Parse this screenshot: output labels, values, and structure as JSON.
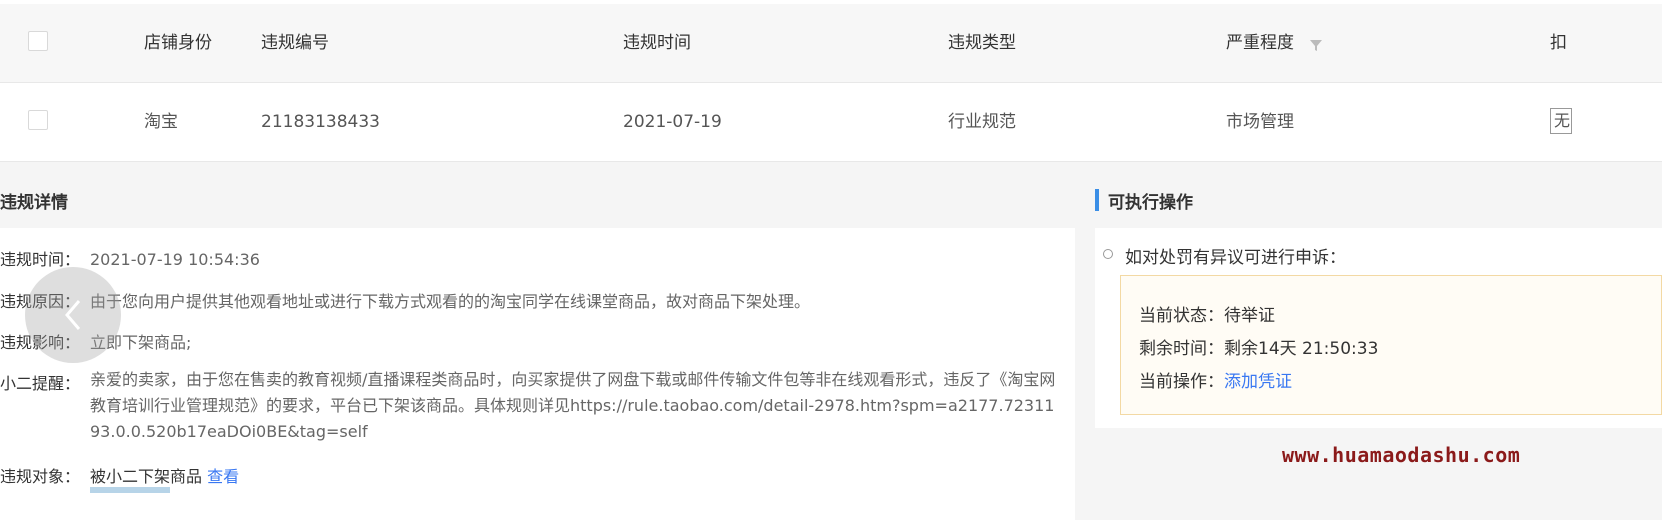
{
  "table": {
    "headers": [
      "店铺身份",
      "违规编号",
      "违规时间",
      "违规类型",
      "严重程度",
      "扣"
    ],
    "row": {
      "shop": "淘宝",
      "id": "21183138433",
      "date": "2021-07-19",
      "type": "行业规范",
      "severity": "市场管理",
      "deduct": "无"
    }
  },
  "details": {
    "title": "违规详情",
    "time_label": "违规时间：",
    "time_value": "2021-07-19 10:54:36",
    "reason_label": "违规原因：",
    "reason_value": "由于您向用户提供其他观看地址或进行下载方式观看的的淘宝同学在线课堂商品，故对商品下架处理。",
    "impact_label": "违规影响：",
    "impact_value": "立即下架商品;",
    "reminder_label": "小二提醒：",
    "reminder_value": "亲爱的卖家，由于您在售卖的教育视频/直播课程类商品时，向买家提供了网盘下载或邮件传输文件包等非在线观看形式，违反了《淘宝网教育培训行业管理规范》的要求，平台已下架该商品。具体规则详见https://rule.taobao.com/detail-2978.htm?spm=a2177.7231193.0.0.520b17eaDOi0BE&tag=self",
    "object_label": "违规对象：",
    "object_value": "被小二下架商品",
    "object_link": "查看"
  },
  "actions": {
    "title": "可执行操作",
    "appeal_text": "如对处罚有异议可进行申诉：",
    "status_label": "当前状态：",
    "status_value": "待举证",
    "remaining_label": "剩余时间：",
    "remaining_value": "剩余14天 21:50:33",
    "operation_label": "当前操作：",
    "operation_link": "添加凭证"
  },
  "watermark": "www.huamaodashu.com",
  "colors": {
    "link": "#3a78f2",
    "accent_bar": "#3a8ee6",
    "watermark": "#8b1a1a"
  }
}
